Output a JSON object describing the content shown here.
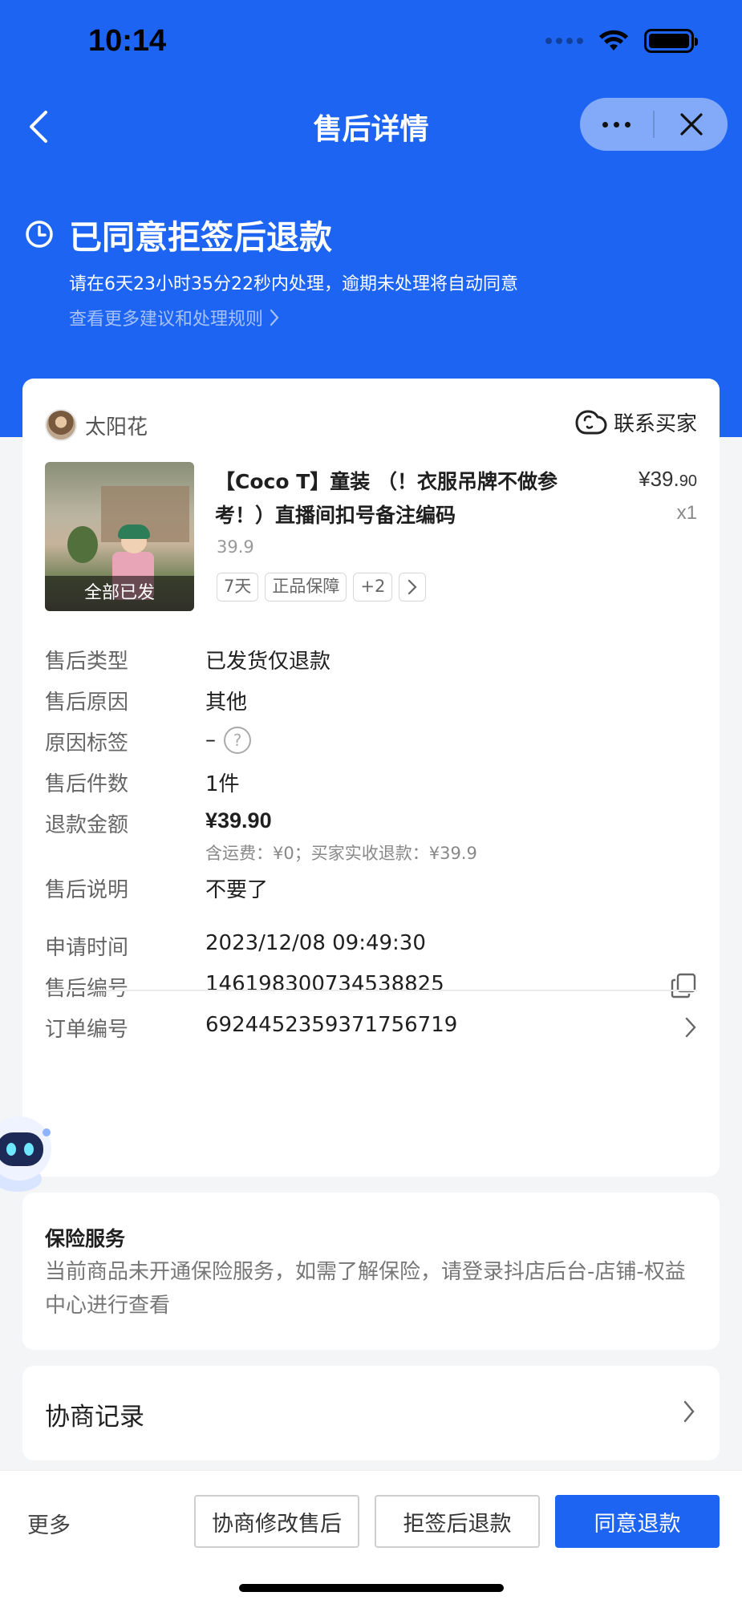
{
  "status_bar": {
    "time": "10:14"
  },
  "nav": {
    "title": "售后详情"
  },
  "status": {
    "title": "已同意拒签后退款",
    "desc": "请在6天23小时35分22秒内处理，逾期未处理将自动同意",
    "link": "查看更多建议和处理规则"
  },
  "buyer": {
    "name": "太阳花",
    "contact_label": "联系买家"
  },
  "product": {
    "image_badge": "全部已发",
    "title": "【Coco T】童装 （！衣服吊牌不做参考！）直播间扣号备注编码",
    "price_main": "¥39.",
    "price_decimal": "90",
    "qty": "x1",
    "unit_price": "39.9",
    "tags": [
      "7天",
      "正品保障",
      "+2"
    ]
  },
  "details": {
    "type_label": "售后类型",
    "type_value": "已发货仅退款",
    "reason_label": "售后原因",
    "reason_value": "其他",
    "reason_tag_label": "原因标签",
    "reason_tag_value": "–",
    "count_label": "售后件数",
    "count_value": "1件",
    "refund_label": "退款金额",
    "refund_value": "¥39.90",
    "refund_note": "含运费：¥0；买家实收退款：¥39.9",
    "desc_label": "售后说明",
    "desc_value": "不要了",
    "apply_time_label": "申请时间",
    "apply_time_value": "2023/12/08 09:49:30",
    "aftersale_no_label": "售后编号",
    "aftersale_no_value": "146198300734538825",
    "order_no_label": "订单编号",
    "order_no_value": "6924452359371756719"
  },
  "insurance": {
    "title": "保险服务",
    "text": "当前商品未开通保险服务，如需了解保险，请登录抖店后台-店铺-权益中心进行查看"
  },
  "negotiation": {
    "title": "协商记录"
  },
  "bottom": {
    "more": "更多",
    "btn_modify": "协商修改售后",
    "btn_reject_refund": "拒签后退款",
    "btn_agree": "同意退款"
  },
  "colors": {
    "brand_blue": "#1d64f2",
    "background": "#f4f5f7"
  }
}
